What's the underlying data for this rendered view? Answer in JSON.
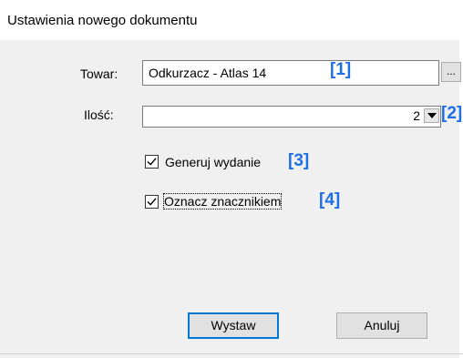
{
  "window": {
    "title": "Ustawienia nowego dokumentu"
  },
  "form": {
    "towar": {
      "label": "Towar:",
      "value": "Odkurzacz - Atlas 14",
      "browse_label": "...",
      "marker": "[1]"
    },
    "ilosc": {
      "label": "Ilość:",
      "value": "2",
      "marker": "[2]"
    },
    "generuj": {
      "label": "Generuj wydanie",
      "checked": true,
      "marker": "[3]"
    },
    "oznacz": {
      "label": "Oznacz znacznikiem",
      "checked": true,
      "marker": "[4]"
    }
  },
  "buttons": {
    "ok_label": "Wystaw",
    "cancel_label": "Anuluj"
  },
  "colors": {
    "marker": "#1e6fe6",
    "default_button_border": "#0078d7"
  },
  "icons": {
    "checkbox_mark": "check-icon",
    "dropdown": "chevron-down-icon"
  }
}
